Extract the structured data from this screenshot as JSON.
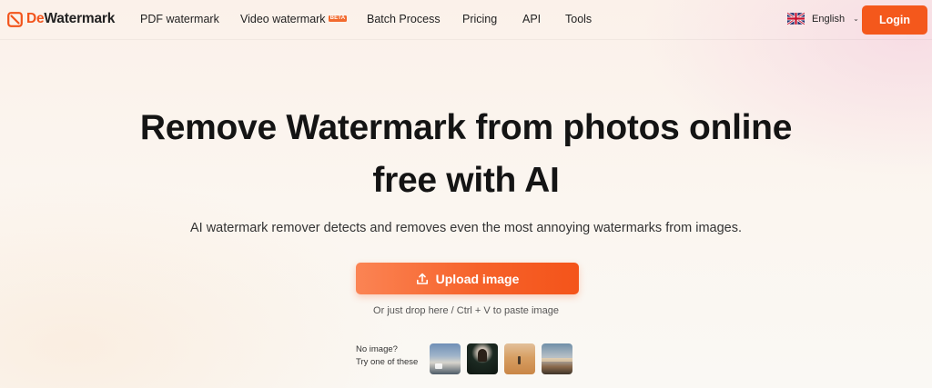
{
  "brand": {
    "name_prefix": "De",
    "name_suffix": "Watermark",
    "accent": "#f4581c"
  },
  "nav": {
    "links": [
      {
        "label": "PDF watermark"
      },
      {
        "label": "Video watermark",
        "badge": "BETA"
      },
      {
        "label": "Batch Process"
      },
      {
        "label": "Pricing"
      },
      {
        "label": "API"
      },
      {
        "label": "Tools"
      }
    ],
    "language": "English",
    "login_label": "Login"
  },
  "hero": {
    "title_line1": "Remove Watermark from photos online",
    "title_line2": "free with AI",
    "subtitle": "AI watermark remover detects and removes even the most annoying watermarks from images.",
    "upload_label": "Upload image",
    "drop_hint": "Or just drop here / Ctrl + V to paste image",
    "samples_line1": "No image?",
    "samples_line2": "Try one of these"
  },
  "icons": {
    "logo": "dewatermark-logo-icon",
    "flag": "uk-flag-icon",
    "chevron": "chevron-down-icon",
    "upload": "upload-icon"
  }
}
